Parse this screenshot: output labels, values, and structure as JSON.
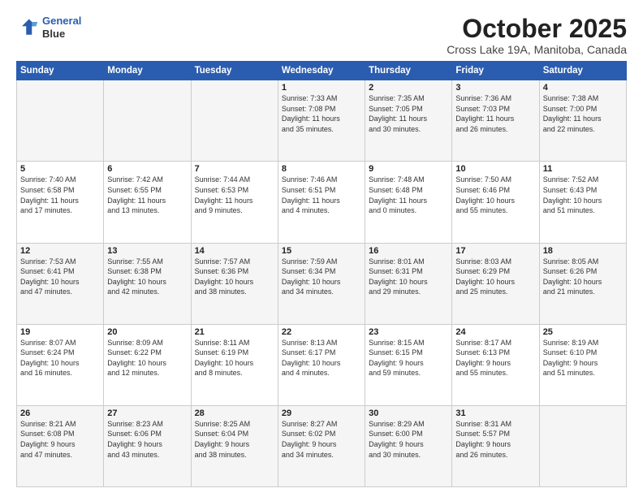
{
  "header": {
    "logo_line1": "General",
    "logo_line2": "Blue",
    "title": "October 2025",
    "subtitle": "Cross Lake 19A, Manitoba, Canada"
  },
  "days_of_week": [
    "Sunday",
    "Monday",
    "Tuesday",
    "Wednesday",
    "Thursday",
    "Friday",
    "Saturday"
  ],
  "weeks": [
    [
      {
        "day": "",
        "info": ""
      },
      {
        "day": "",
        "info": ""
      },
      {
        "day": "",
        "info": ""
      },
      {
        "day": "1",
        "info": "Sunrise: 7:33 AM\nSunset: 7:08 PM\nDaylight: 11 hours\nand 35 minutes."
      },
      {
        "day": "2",
        "info": "Sunrise: 7:35 AM\nSunset: 7:05 PM\nDaylight: 11 hours\nand 30 minutes."
      },
      {
        "day": "3",
        "info": "Sunrise: 7:36 AM\nSunset: 7:03 PM\nDaylight: 11 hours\nand 26 minutes."
      },
      {
        "day": "4",
        "info": "Sunrise: 7:38 AM\nSunset: 7:00 PM\nDaylight: 11 hours\nand 22 minutes."
      }
    ],
    [
      {
        "day": "5",
        "info": "Sunrise: 7:40 AM\nSunset: 6:58 PM\nDaylight: 11 hours\nand 17 minutes."
      },
      {
        "day": "6",
        "info": "Sunrise: 7:42 AM\nSunset: 6:55 PM\nDaylight: 11 hours\nand 13 minutes."
      },
      {
        "day": "7",
        "info": "Sunrise: 7:44 AM\nSunset: 6:53 PM\nDaylight: 11 hours\nand 9 minutes."
      },
      {
        "day": "8",
        "info": "Sunrise: 7:46 AM\nSunset: 6:51 PM\nDaylight: 11 hours\nand 4 minutes."
      },
      {
        "day": "9",
        "info": "Sunrise: 7:48 AM\nSunset: 6:48 PM\nDaylight: 11 hours\nand 0 minutes."
      },
      {
        "day": "10",
        "info": "Sunrise: 7:50 AM\nSunset: 6:46 PM\nDaylight: 10 hours\nand 55 minutes."
      },
      {
        "day": "11",
        "info": "Sunrise: 7:52 AM\nSunset: 6:43 PM\nDaylight: 10 hours\nand 51 minutes."
      }
    ],
    [
      {
        "day": "12",
        "info": "Sunrise: 7:53 AM\nSunset: 6:41 PM\nDaylight: 10 hours\nand 47 minutes."
      },
      {
        "day": "13",
        "info": "Sunrise: 7:55 AM\nSunset: 6:38 PM\nDaylight: 10 hours\nand 42 minutes."
      },
      {
        "day": "14",
        "info": "Sunrise: 7:57 AM\nSunset: 6:36 PM\nDaylight: 10 hours\nand 38 minutes."
      },
      {
        "day": "15",
        "info": "Sunrise: 7:59 AM\nSunset: 6:34 PM\nDaylight: 10 hours\nand 34 minutes."
      },
      {
        "day": "16",
        "info": "Sunrise: 8:01 AM\nSunset: 6:31 PM\nDaylight: 10 hours\nand 29 minutes."
      },
      {
        "day": "17",
        "info": "Sunrise: 8:03 AM\nSunset: 6:29 PM\nDaylight: 10 hours\nand 25 minutes."
      },
      {
        "day": "18",
        "info": "Sunrise: 8:05 AM\nSunset: 6:26 PM\nDaylight: 10 hours\nand 21 minutes."
      }
    ],
    [
      {
        "day": "19",
        "info": "Sunrise: 8:07 AM\nSunset: 6:24 PM\nDaylight: 10 hours\nand 16 minutes."
      },
      {
        "day": "20",
        "info": "Sunrise: 8:09 AM\nSunset: 6:22 PM\nDaylight: 10 hours\nand 12 minutes."
      },
      {
        "day": "21",
        "info": "Sunrise: 8:11 AM\nSunset: 6:19 PM\nDaylight: 10 hours\nand 8 minutes."
      },
      {
        "day": "22",
        "info": "Sunrise: 8:13 AM\nSunset: 6:17 PM\nDaylight: 10 hours\nand 4 minutes."
      },
      {
        "day": "23",
        "info": "Sunrise: 8:15 AM\nSunset: 6:15 PM\nDaylight: 9 hours\nand 59 minutes."
      },
      {
        "day": "24",
        "info": "Sunrise: 8:17 AM\nSunset: 6:13 PM\nDaylight: 9 hours\nand 55 minutes."
      },
      {
        "day": "25",
        "info": "Sunrise: 8:19 AM\nSunset: 6:10 PM\nDaylight: 9 hours\nand 51 minutes."
      }
    ],
    [
      {
        "day": "26",
        "info": "Sunrise: 8:21 AM\nSunset: 6:08 PM\nDaylight: 9 hours\nand 47 minutes."
      },
      {
        "day": "27",
        "info": "Sunrise: 8:23 AM\nSunset: 6:06 PM\nDaylight: 9 hours\nand 43 minutes."
      },
      {
        "day": "28",
        "info": "Sunrise: 8:25 AM\nSunset: 6:04 PM\nDaylight: 9 hours\nand 38 minutes."
      },
      {
        "day": "29",
        "info": "Sunrise: 8:27 AM\nSunset: 6:02 PM\nDaylight: 9 hours\nand 34 minutes."
      },
      {
        "day": "30",
        "info": "Sunrise: 8:29 AM\nSunset: 6:00 PM\nDaylight: 9 hours\nand 30 minutes."
      },
      {
        "day": "31",
        "info": "Sunrise: 8:31 AM\nSunset: 5:57 PM\nDaylight: 9 hours\nand 26 minutes."
      },
      {
        "day": "",
        "info": ""
      }
    ]
  ]
}
